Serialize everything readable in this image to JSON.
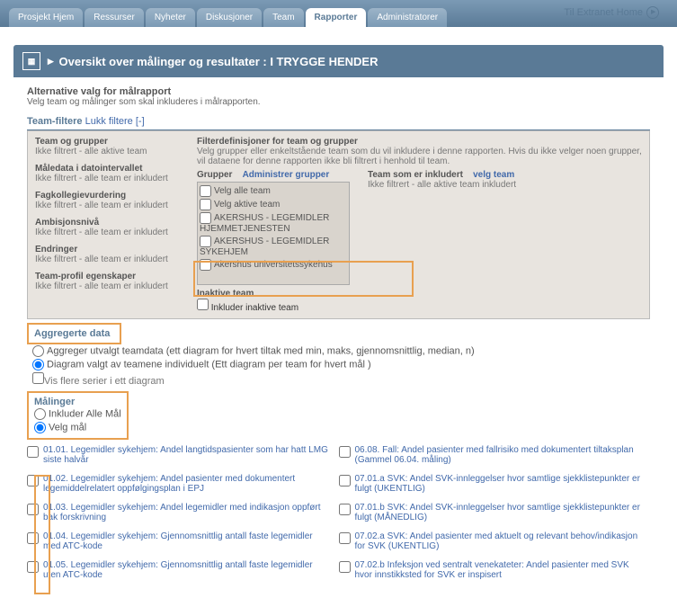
{
  "nav": {
    "tabs": [
      "Prosjekt Hjem",
      "Ressurser",
      "Nyheter",
      "Diskusjoner",
      "Team",
      "Rapporter",
      "Administratorer"
    ],
    "activeIndex": 5,
    "homeLink": "Til Extranet Home"
  },
  "header": {
    "title": "Oversikt over målinger og resultater : I TRYGGE HENDER"
  },
  "altValg": {
    "heading": "Alternative valg for målrapport",
    "sub": "Velg team og målinger som skal inkluderes i målrapporten."
  },
  "teamFilter": {
    "label": "Team-filtere",
    "toggle": "Lukk filtere [-]",
    "leftItems": [
      {
        "title": "Team og grupper",
        "desc": "Ikke filtrert - alle aktive team"
      },
      {
        "title": "Måledata i datointervallet",
        "desc": "Ikke filtrert - alle team er inkludert"
      },
      {
        "title": "Fagkollegievurdering",
        "desc": "Ikke filtrert - alle team er inkludert"
      },
      {
        "title": "Ambisjonsnivå",
        "desc": "Ikke filtrert - alle team er inkludert"
      },
      {
        "title": "Endringer",
        "desc": "Ikke filtrert - alle team er inkludert"
      },
      {
        "title": "Team-profil egenskaper",
        "desc": "Ikke filtrert - alle team er inkludert"
      }
    ],
    "right": {
      "defTitle": "Filterdefinisjoner for team og grupper",
      "defDesc": "Velg grupper eller enkeltstående team som du vil inkludere i denne rapporten. Hvis du ikke velger noen grupper, vil dataene for denne rapporten ikke bli filtrert i henhold til team.",
      "grupperLabel": "Grupper",
      "adminLink": "Administrer grupper",
      "teamInkLabel": "Team som er inkludert",
      "velgTeamLink": "velg team",
      "teamInkDesc": "Ikke filtrert - alle aktive team inkludert",
      "options": [
        "Velg alle team",
        "Velg aktive team",
        "AKERSHUS - LEGEMIDLER HJEMMETJENESTEN",
        "AKERSHUS - LEGEMIDLER SYKEHJEM",
        "Akershus universitetssykehus"
      ],
      "inactiveLabel": "Inaktive team",
      "inactiveOption": "Inkluder inaktive team"
    }
  },
  "aggregerte": {
    "heading": "Aggregerte data",
    "opt1": "Aggreger utvalgt teamdata (ett diagram for hvert tiltak med min, maks, gjennomsnittlig, median, n)",
    "opt2": "Diagram valgt av teamene individuelt (Ett diagram per team for hvert mål )",
    "visFlere": "Vis flere serier i ett diagram"
  },
  "malinger": {
    "heading": "Målinger",
    "opt1": "Inkluder Alle Mål",
    "opt2": "Velg mål"
  },
  "malListLeft": [
    "01.01. Legemidler sykehjem: Andel langtidspasienter som har hatt LMG siste halvår",
    "01.02. Legemidler sykehjem: Andel pasienter med dokumentert legemiddelrelatert oppfølgingsplan i EPJ",
    "01.03. Legemidler sykehjem: Andel legemidler med indikasjon oppført bak forskrivning",
    "01.04. Legemidler sykehjem: Gjennomsnittlig antall faste legemidler med ATC-kode",
    "01.05. Legemidler sykehjem: Gjennomsnittlig antall faste legemidler uten ATC-kode"
  ],
  "malListRight": [
    "06.08. Fall: Andel pasienter med fallrisiko med dokumentert tiltaksplan (Gammel 06.04. måling)",
    "07.01.a SVK: Andel SVK-innleggelser hvor samtlige sjekklistepunkter er fulgt (UKENTLIG)",
    "07.01.b SVK: Andel SVK-innleggelser hvor samtlige sjekklistepunkter er fulgt (MÅNEDLIG)",
    "07.02.a SVK: Andel pasienter med aktuelt og relevant behov/indikasjon for SVK (UKENTLIG)",
    "07.02.b Infeksjon ved sentralt venekateter: Andel pasienter med SVK hvor innstikksted for SVK er inspisert"
  ]
}
